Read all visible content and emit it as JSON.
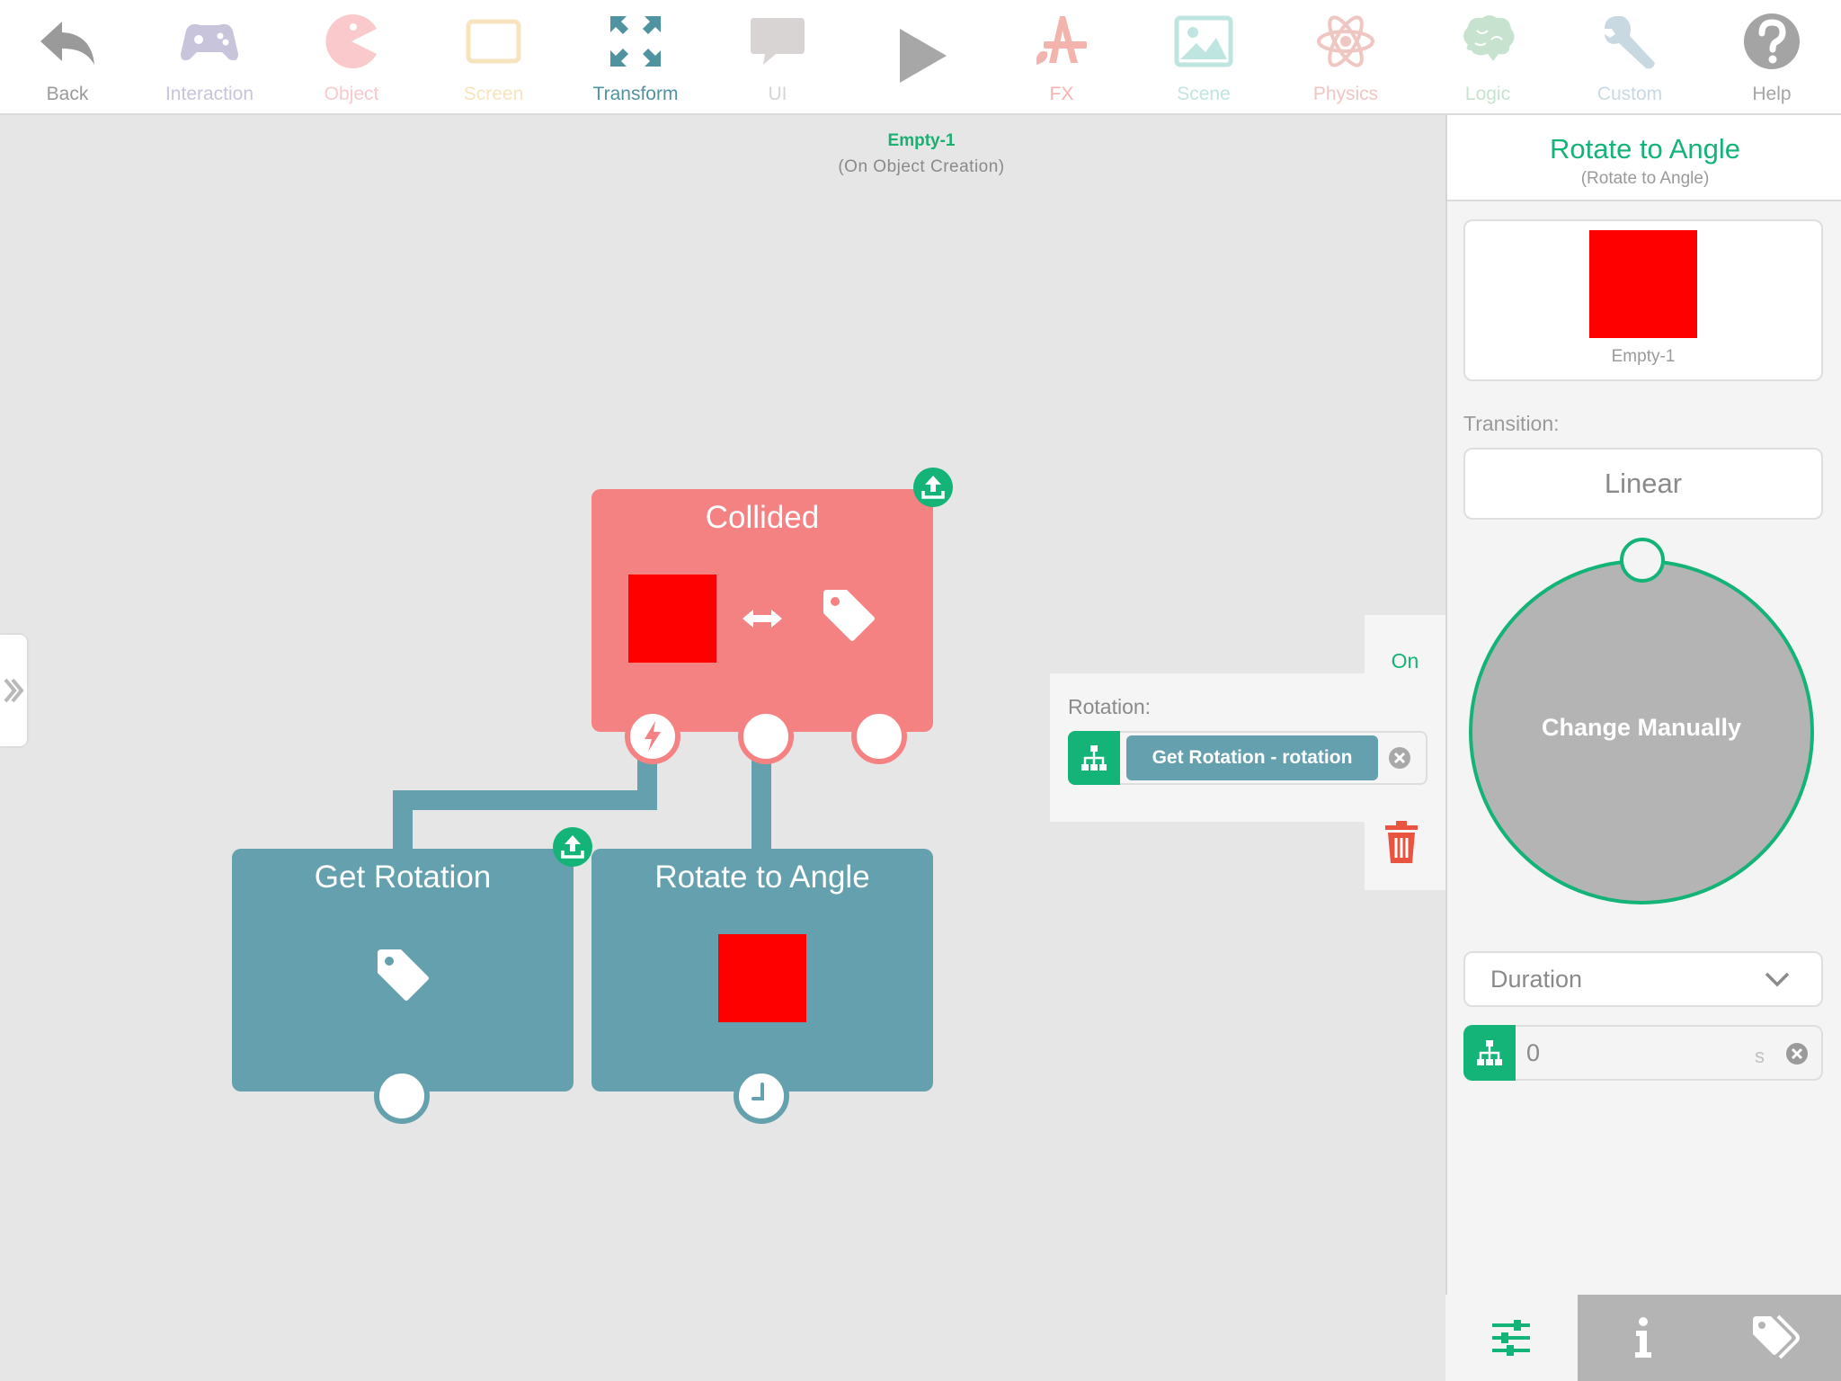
{
  "toolbar": {
    "back": {
      "label": "Back",
      "icon": "back-arrow-icon",
      "color": "#9a9a9a"
    },
    "interaction": {
      "label": "Interaction",
      "icon": "gamepad-icon",
      "color": "#c8c4dc"
    },
    "object": {
      "label": "Object",
      "icon": "pacman-icon",
      "color": "#f9c9cc"
    },
    "screen": {
      "label": "Screen",
      "icon": "tablet-icon",
      "color": "#f7e4bf"
    },
    "transform": {
      "label": "Transform",
      "icon": "transform-arrows-icon",
      "color": "#4f93a0"
    },
    "ui": {
      "label": "UI",
      "icon": "speech-bubble-icon",
      "color": "#d9d4d4"
    },
    "play": {
      "icon": "play-icon",
      "color": "#a7a7a7"
    },
    "fx": {
      "label": "FX",
      "icon": "fx-brush-icon",
      "color": "#f3b4ad"
    },
    "scene": {
      "label": "Scene",
      "icon": "picture-icon",
      "color": "#bfe5e1"
    },
    "physics": {
      "label": "Physics",
      "icon": "atom-icon",
      "color": "#f0c6c2"
    },
    "logic": {
      "label": "Logic",
      "icon": "brain-icon",
      "color": "#c7e3cf"
    },
    "custom": {
      "label": "Custom",
      "icon": "wrench-icon",
      "color": "#c9d9e2"
    },
    "help": {
      "label": "Help",
      "icon": "question-icon",
      "color": "#a4a4a4"
    }
  },
  "context": {
    "title": "Empty-1",
    "subtitle": "(On Object Creation)"
  },
  "nodes": {
    "collided": {
      "title": "Collided",
      "color": "#f58283"
    },
    "get_rotation": {
      "title": "Get Rotation",
      "color": "#64a0ad"
    },
    "rotate_to_angle": {
      "title": "Rotate to Angle",
      "color": "#64a0ad"
    }
  },
  "rotation_panel": {
    "label": "Rotation:",
    "value": "Get Rotation - rotation",
    "on_label": "On"
  },
  "inspector": {
    "title": "Rotate to Angle",
    "subtitle": "(Rotate to Angle)",
    "object_name": "Empty-1",
    "transition_label": "Transition:",
    "transition_value": "Linear",
    "dial_label": "Change Manually",
    "duration_label": "Duration",
    "duration_value": "0",
    "duration_unit": "s"
  },
  "colors": {
    "accent": "#14b377",
    "object_red": "#ff0000",
    "trash": "#e8543f"
  }
}
